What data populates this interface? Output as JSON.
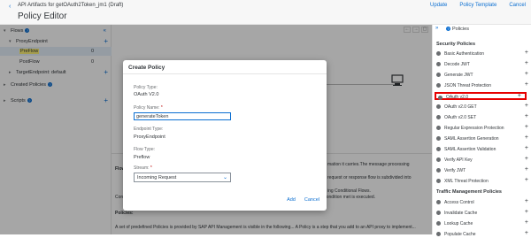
{
  "header": {
    "breadcrumb": "API Artifacts for getOAuth2Token_jm1 (Draft)",
    "title": "Policy Editor",
    "actions": [
      "Update",
      "Policy Template",
      "Cancel"
    ]
  },
  "left": {
    "flows_label": "Flows",
    "proxy_endpoint": "ProxyEndpoint",
    "preflow": "PreFlow",
    "preflow_count": "0",
    "postflow": "PostFlow",
    "postflow_count": "0",
    "target_endpoint": "TargetEndpoint: default",
    "created_policies": "Created Policies",
    "scripts": "Scripts"
  },
  "bottom": {
    "line1_head": "Flow",
    "line1_tail": "mation it carries.The message processing",
    "line2_tail": "request or response flow is subdivided into",
    "line3_tail": "ing Conditional Flows.",
    "line4": "Conditional Flow: A condition associated to a flow. A flow can contain one or more conditions. Only the first condition met is executed.",
    "policies_label": "Policies:",
    "line5": "A set of predefined Policies is provided by SAP API Management is visible in the following... A Policy is a step that you add to an API proxy to implement..."
  },
  "right": {
    "title": "Policies",
    "security_title": "Security Policies",
    "security": [
      "Basic Authentication",
      "Decode JWT",
      "Generate JWT",
      "JSON Threat Protection",
      "OAuth v2.0",
      "OAuth v2.0 GET",
      "OAuth v2.0 SET",
      "Regular Expression Protection",
      "SAML Assertion Generation",
      "SAML Assertion Validation",
      "Verify API Key",
      "Verify JWT",
      "XML Threat Protection"
    ],
    "traffic_title": "Traffic Management Policies",
    "traffic": [
      "Access Control",
      "Invalidate Cache",
      "Lookup Cache",
      "Populate Cache"
    ]
  },
  "dialog": {
    "title": "Create Policy",
    "policy_type_label": "Policy Type:",
    "policy_type": "OAuth V2.0",
    "policy_name_label": "Policy Name:",
    "policy_name": "generateToken",
    "endpoint_type_label": "Endpoint Type:",
    "endpoint_type": "ProxyEndpoint",
    "flow_type_label": "Flow Type:",
    "flow_type": "Preflow",
    "stream_label": "Stream:",
    "stream": "Incoming Request",
    "add_label": "Add",
    "cancel_label": "Cancel"
  }
}
